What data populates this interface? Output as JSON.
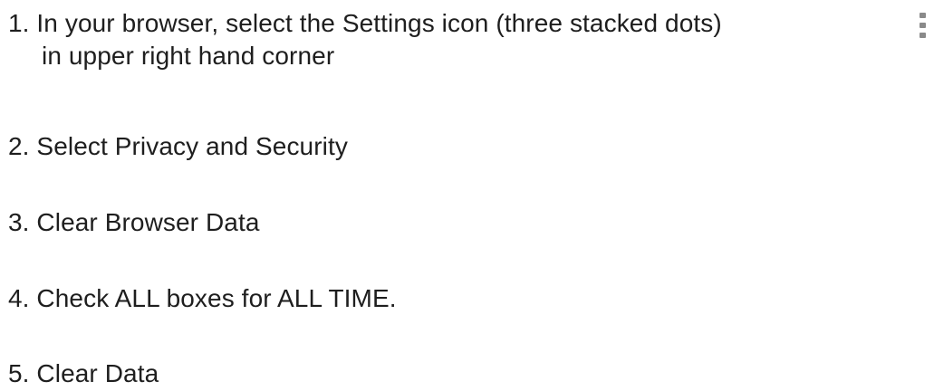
{
  "steps": [
    {
      "line1": "1. In your browser, select the Settings icon (three stacked dots)",
      "line2": "in upper right hand corner"
    },
    {
      "line1": "2. Select Privacy and Security"
    },
    {
      "line1": "3. Clear Browser Data"
    },
    {
      "line1": "4. Check ALL boxes for ALL TIME."
    },
    {
      "line1": "5. Clear Data"
    }
  ],
  "icons": {
    "settings_icon": "three-vertical-dots-icon",
    "dot_color": "#8a8a8a"
  }
}
